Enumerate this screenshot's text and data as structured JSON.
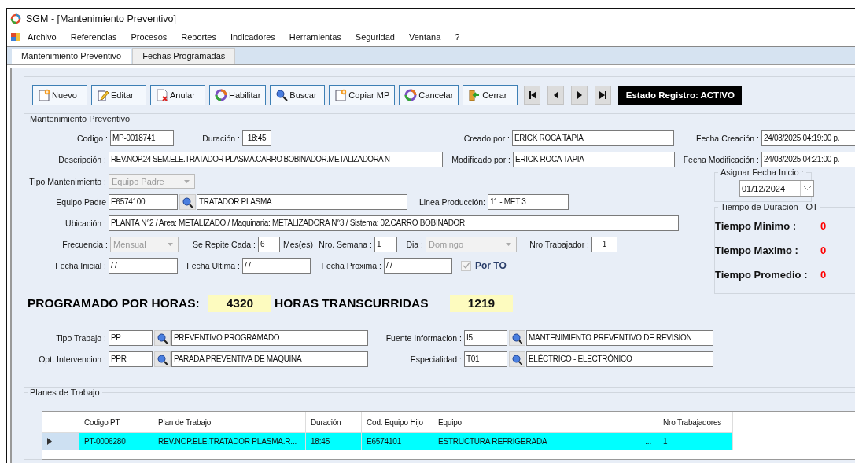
{
  "window": {
    "title": "SGM - [Mantenimiento Preventivo]"
  },
  "menu": [
    "Archivo",
    "Referencias",
    "Procesos",
    "Reportes",
    "Indicadores",
    "Herramientas",
    "Seguridad",
    "Ventana",
    "?"
  ],
  "tabs": [
    {
      "label": "Mantenimiento Preventivo",
      "selected": true
    },
    {
      "label": "Fechas Programadas",
      "selected": false
    }
  ],
  "toolbar": {
    "buttons": [
      {
        "label": "Nuevo",
        "kind": "new"
      },
      {
        "label": "Editar",
        "kind": "edit"
      },
      {
        "label": "Anular",
        "kind": "void"
      },
      {
        "label": "Habilitar",
        "kind": "enable"
      },
      {
        "label": "Buscar",
        "kind": "search"
      },
      {
        "label": "Copiar MP",
        "kind": "new"
      },
      {
        "label": "Cancelar",
        "kind": "enable"
      },
      {
        "label": "Cerrar",
        "kind": "exit"
      }
    ],
    "nav": [
      {
        "kind": "first"
      },
      {
        "kind": "prev"
      },
      {
        "kind": "next"
      },
      {
        "kind": "last"
      }
    ],
    "status": "Estado Registro: ACTIVO"
  },
  "form": {
    "title": "Mantenimiento Preventivo",
    "rows": [
      {
        "items": [
          {
            "kind": "label",
            "text": "Codigo :"
          },
          {
            "kind": "field",
            "value": "MP-0018741"
          },
          {
            "kind": "label",
            "text": "Duración :"
          },
          {
            "kind": "field",
            "value": "18:45"
          },
          {
            "kind": "label",
            "text": "Creado por :"
          },
          {
            "kind": "field",
            "value": "ERICK ROCA TAPIA"
          },
          {
            "kind": "label",
            "text": "Fecha Creación :"
          },
          {
            "kind": "field",
            "value": "24/03/2025 04:19:00 p."
          }
        ]
      },
      {
        "items": [
          {
            "kind": "label",
            "text": "Descripción :"
          },
          {
            "kind": "field",
            "value": "REV.NOP.24 SEM.ELE.TRATADOR PLASMA.CARRO BOBINADOR.METALIZADORA N"
          },
          {
            "kind": "label",
            "text": "Modificado por :"
          },
          {
            "kind": "field",
            "value": "ERICK ROCA TAPIA"
          },
          {
            "kind": "label",
            "text": "Fecha Modificación :"
          },
          {
            "kind": "field",
            "value": "24/03/2025 04:21:00 p."
          }
        ]
      },
      {
        "items": [
          {
            "kind": "label",
            "text": "Tipo Mantenimiento :"
          },
          {
            "kind": "combo",
            "value": "Equipo Padre",
            "disabled": true
          }
        ]
      },
      {
        "items": [
          {
            "kind": "label",
            "text": "Equipo Padre"
          },
          {
            "kind": "field",
            "value": "E6574100"
          },
          {
            "kind": "lookup"
          },
          {
            "kind": "field",
            "value": "TRATADOR PLASMA"
          },
          {
            "kind": "label",
            "text": "Linea Producción:"
          },
          {
            "kind": "field",
            "value": "11 - MET 3"
          }
        ]
      },
      {
        "items": [
          {
            "kind": "label",
            "text": "Ubicación :"
          },
          {
            "kind": "field",
            "value": "PLANTA N°2 / Area: METALIZADO / Maquinaria: METALIZADORA N°3 / Sistema: 02.CARRO BOBINADOR"
          }
        ]
      },
      {
        "items": [
          {
            "kind": "label",
            "text": "Frecuencia :"
          },
          {
            "kind": "combo",
            "value": "Mensual",
            "disabled": true
          },
          {
            "kind": "label",
            "text": "Se Repite Cada :"
          },
          {
            "kind": "field",
            "value": "6"
          },
          {
            "kind": "unit",
            "text": "Mes(es)"
          },
          {
            "kind": "label",
            "text": "Nro. Semana :"
          },
          {
            "kind": "field",
            "value": "1"
          },
          {
            "kind": "label",
            "text": "Dia :"
          },
          {
            "kind": "combo",
            "value": "Domingo",
            "disabled": true
          },
          {
            "kind": "label",
            "text": "Nro Trabajador :"
          },
          {
            "kind": "field",
            "value": "1"
          }
        ]
      },
      {
        "items": [
          {
            "kind": "label",
            "text": "Fecha Inicial :"
          },
          {
            "kind": "field",
            "value": "/ /"
          },
          {
            "kind": "label",
            "text": "Fecha Ultima :"
          },
          {
            "kind": "field",
            "value": "/ /"
          },
          {
            "kind": "label",
            "text": "Fecha Proxima :"
          },
          {
            "kind": "field",
            "value": "/ /"
          },
          {
            "kind": "check",
            "text": "Por TO",
            "checked": true,
            "disabled": true
          }
        ]
      },
      {
        "items": [
          {
            "kind": "heading",
            "text": "PROGRAMADO POR HORAS:"
          },
          {
            "kind": "counter",
            "value": "4320"
          },
          {
            "kind": "heading",
            "text": "HORAS TRANSCURRIDAS"
          },
          {
            "kind": "counter",
            "value": "1219"
          }
        ]
      },
      {
        "items": [
          {
            "kind": "label",
            "text": "Tipo Trabajo :"
          },
          {
            "kind": "field",
            "value": "PP"
          },
          {
            "kind": "lookup"
          },
          {
            "kind": "field",
            "value": "PREVENTIVO PROGRAMADO"
          },
          {
            "kind": "label",
            "text": "Fuente Informacion :"
          },
          {
            "kind": "field",
            "value": "I5"
          },
          {
            "kind": "lookup"
          },
          {
            "kind": "field",
            "value": "MANTENIMIENTO PREVENTIVO DE REVISION"
          }
        ]
      },
      {
        "items": [
          {
            "kind": "label",
            "text": "Opt. Intervencion :"
          },
          {
            "kind": "field",
            "value": "PPR"
          },
          {
            "kind": "lookup"
          },
          {
            "kind": "field",
            "value": "PARADA PREVENTIVA DE MAQUINA"
          },
          {
            "kind": "label",
            "text": "Especialidad :"
          },
          {
            "kind": "field",
            "value": "T01"
          },
          {
            "kind": "lookup"
          },
          {
            "kind": "field",
            "value": "ELÉCTRICO - ELECTRÓNICO"
          }
        ]
      }
    ],
    "asignar": {
      "title": "Asignar Fecha Inicio :",
      "value": "01/12/2024"
    },
    "tiempos": {
      "title": "Tiempo de Duración - OT",
      "rows": [
        {
          "label": "Tiempo Minimo :",
          "value": "0"
        },
        {
          "label": "Tiempo Maximo :",
          "value": "0"
        },
        {
          "label": "Tiempo Promedio :",
          "value": "0"
        }
      ]
    }
  },
  "planes": {
    "title": "Planes de Trabajo",
    "columns": [
      "Codigo PT",
      "Plan de Trabajo",
      "Duración",
      "Cod. Equipo Hijo",
      "Equipo",
      "Nro Trabajadores"
    ],
    "rows": [
      {
        "selected": true,
        "cells": [
          "PT-0006280",
          "REV.NOP.ELE.TRATADOR PLASMA.R...",
          "18:45",
          "E6574101",
          "ESTRUCTURA REFRIGERADA",
          "1"
        ],
        "ellipsis": "..."
      }
    ]
  }
}
